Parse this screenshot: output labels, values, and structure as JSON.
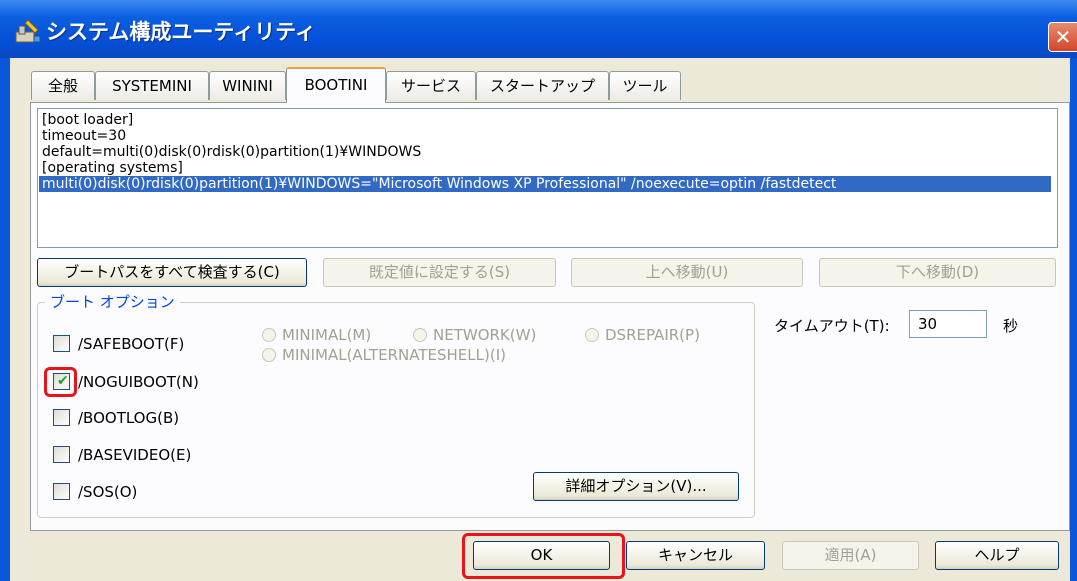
{
  "window": {
    "title": "システム構成ユーティリティ",
    "close_glyph": "✕"
  },
  "tabs": [
    {
      "label": "全般"
    },
    {
      "label": "SYSTEMINI"
    },
    {
      "label": "WININI"
    },
    {
      "label": "BOOTINI"
    },
    {
      "label": "サービス"
    },
    {
      "label": "スタートアップ"
    },
    {
      "label": "ツール"
    }
  ],
  "active_tab": "BOOTINI",
  "boot_ini": {
    "lines": [
      "[boot loader]",
      "timeout=30",
      "default=multi(0)disk(0)rdisk(0)partition(1)¥WINDOWS",
      "[operating systems]",
      "multi(0)disk(0)rdisk(0)partition(1)¥WINDOWS=\"Microsoft Windows XP Professional\" /noexecute=optin /fastdetect"
    ],
    "selected_index": 4
  },
  "actions": {
    "check_all_paths": "ブートパスをすべて検査する(C)",
    "set_default": "既定値に設定する(S)",
    "move_up": "上へ移動(U)",
    "move_down": "下へ移動(D)"
  },
  "boot_options": {
    "title": "ブート オプション",
    "safeboot": {
      "label": "/SAFEBOOT(F)",
      "checked": false
    },
    "noguiboot": {
      "label": "/NOGUIBOOT(N)",
      "checked": true
    },
    "bootlog": {
      "label": "/BOOTLOG(B)",
      "checked": false
    },
    "basevideo": {
      "label": "/BASEVIDEO(E)",
      "checked": false
    },
    "sos": {
      "label": "/SOS(O)",
      "checked": false
    },
    "radios": {
      "minimal": "MINIMAL(M)",
      "network": "NETWORK(W)",
      "dsrepair": "DSREPAIR(P)",
      "minimal_alt": "MINIMAL(ALTERNATESHELL)(I)"
    },
    "advanced_button": "詳細オプション(V)..."
  },
  "timeout": {
    "label": "タイムアウト(T):",
    "value": "30",
    "unit": "秒"
  },
  "dialog_buttons": {
    "ok": "OK",
    "cancel": "キャンセル",
    "apply": "適用(A)",
    "help": "ヘルプ"
  },
  "colors": {
    "titlebar": "#0550d7",
    "selection": "#316ac5",
    "highlight_box": "#e8141c",
    "group_title": "#0046d5"
  }
}
